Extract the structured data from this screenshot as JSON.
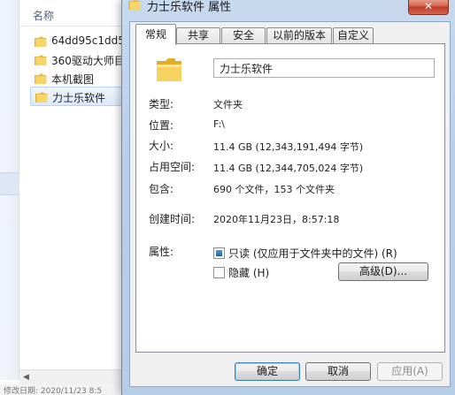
{
  "explorer": {
    "column_header": "名称",
    "files": [
      {
        "name": "64dd95c1dd5",
        "selected": false
      },
      {
        "name": "360驱动大师目",
        "selected": false
      },
      {
        "name": "本机截图",
        "selected": false
      },
      {
        "name": "力士乐软件",
        "selected": true
      }
    ],
    "status_text": "修改日期: 2020/11/23 8:5"
  },
  "dialog": {
    "title": "力士乐软件 属性",
    "close_glyph": "✕",
    "tabs": [
      "常规",
      "共享",
      "安全",
      "以前的版本",
      "自定义"
    ],
    "active_tab": "常规",
    "folder_name": "力士乐软件",
    "rows": {
      "type": {
        "label": "类型:",
        "value": "文件夹"
      },
      "location": {
        "label": "位置:",
        "value": "F:\\"
      },
      "size": {
        "label": "大小:",
        "value": "11.4 GB (12,343,191,494 字节)"
      },
      "size_on_disk": {
        "label": "占用空间:",
        "value": "11.4 GB (12,344,705,024 字节)"
      },
      "contains": {
        "label": "包含:",
        "value": "690 个文件，153 个文件夹"
      },
      "created": {
        "label": "创建时间:",
        "value": "2020年11月23日，8:57:18"
      },
      "attributes": {
        "label": "属性:"
      }
    },
    "attributes": {
      "readonly_label": "只读 (仅应用于文件夹中的文件) (R)",
      "readonly_state": "indeterminate",
      "hidden_label": "隐藏 (H)",
      "hidden_checked": false,
      "advanced_button": "高级(D)..."
    },
    "buttons": {
      "ok": "确定",
      "cancel": "取消",
      "apply": "应用(A)"
    }
  },
  "colors": {
    "folder_yellow": "#f3c947",
    "title_gradient": "#c7d9ee",
    "selection": "#dce9f9"
  },
  "icons": {
    "folder": "folder-icon",
    "close": "close-icon"
  }
}
